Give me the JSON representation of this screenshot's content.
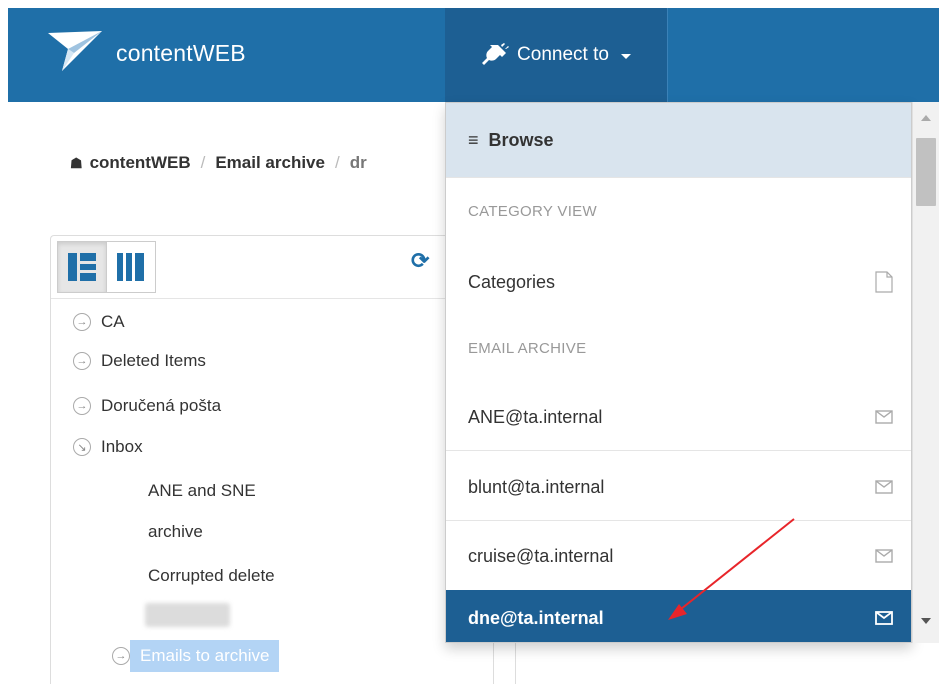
{
  "header": {
    "app_name": "contentWEB",
    "connect_label": "Connect to"
  },
  "breadcrumb": {
    "home": "contentWEB",
    "section": "Email archive",
    "current": "dr"
  },
  "tree": {
    "items": [
      {
        "label": "CA",
        "icon": "arrow-right-circle-icon"
      },
      {
        "label": "Deleted Items",
        "icon": "arrow-right-circle-icon"
      },
      {
        "label": "Doručená pošta",
        "icon": "arrow-right-circle-icon"
      },
      {
        "label": "Inbox",
        "icon": "arrow-down-right-circle-icon"
      },
      {
        "label": "ANE and SNE"
      },
      {
        "label": "archive"
      },
      {
        "label": "Corrupted delete"
      },
      {
        "label": "Emails to archive",
        "icon": "arrow-right-circle-icon",
        "selected": true
      }
    ]
  },
  "dropdown": {
    "header": "Browse",
    "sections": [
      {
        "title": "CATEGORY VIEW"
      },
      {
        "title": "EMAIL ARCHIVE"
      }
    ],
    "items": [
      {
        "label": "Categories",
        "icon": "document-icon"
      },
      {
        "label": "ANE@ta.internal",
        "icon": "mail-icon"
      },
      {
        "label": "blunt@ta.internal",
        "icon": "mail-icon"
      },
      {
        "label": "cruise@ta.internal",
        "icon": "mail-icon"
      },
      {
        "label": "dne@ta.internal",
        "icon": "mail-icon",
        "active": true
      }
    ]
  },
  "colors": {
    "header_bg": "#1f6fa8",
    "active_bg": "#1d5f93",
    "selected_bg": "#b3d4f5",
    "annotation_arrow": "#e8252a"
  }
}
